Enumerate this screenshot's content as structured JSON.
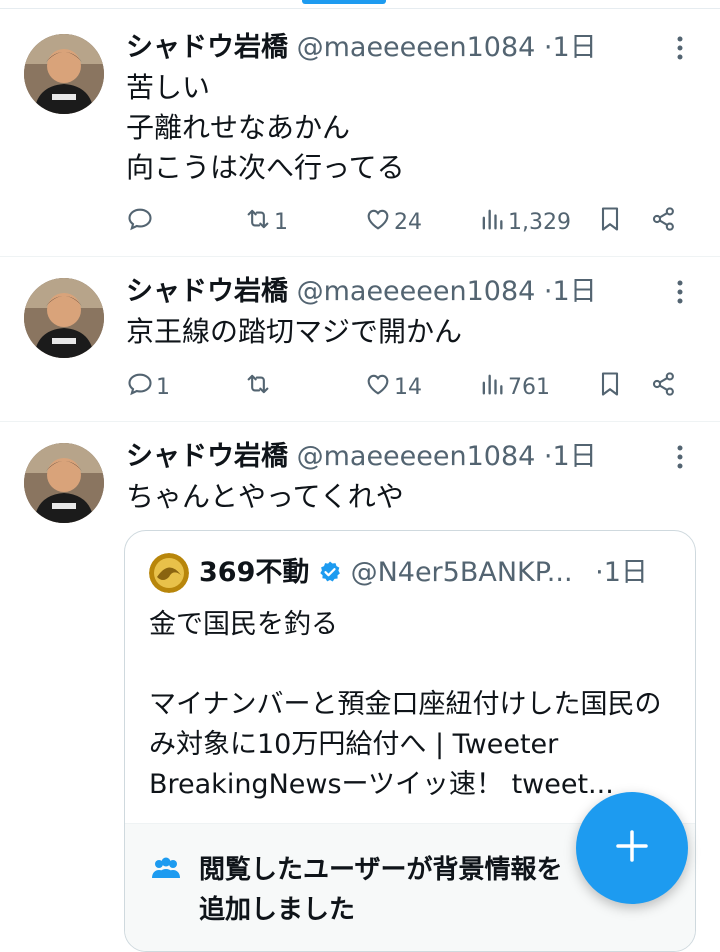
{
  "tweets": [
    {
      "name": "シャドウ岩橋",
      "handle": "@maeeeeen1084",
      "time": "1日",
      "text": "苦しい\n子離れせなあかん\n向こうは次へ行ってる",
      "replies": "",
      "retweets": "1",
      "likes": "24",
      "views": "1,329"
    },
    {
      "name": "シャドウ岩橋",
      "handle": "@maeeeeen1084",
      "time": "1日",
      "text": "京王線の踏切マジで開かん",
      "replies": "1",
      "retweets": "",
      "likes": "14",
      "views": "761"
    },
    {
      "name": "シャドウ岩橋",
      "handle": "@maeeeeen1084",
      "time": "1日",
      "text": "ちゃんとやってくれや"
    }
  ],
  "quote": {
    "name": "369不動",
    "handle": "@N4er5BANKP...",
    "time": "1日",
    "text": "金で国民を釣る\n\nマイナンバーと預金口座紐付けした国民のみ対象に10万円給付へ | Tweeter BreakingNewsーツイッ速！ tweet...",
    "note": "閲覧したユーザーが背景情報を追加しました"
  },
  "separator": "·",
  "colors": {
    "accent": "#1d9bf0",
    "muted": "#536471",
    "text": "#0f1419",
    "verified": "#1d9bf0"
  },
  "icons": [
    "reply-icon",
    "retweet-icon",
    "like-icon",
    "views-icon",
    "bookmark-icon",
    "share-icon",
    "more-icon",
    "verified-icon",
    "community-notes-icon",
    "compose-plus-icon"
  ]
}
